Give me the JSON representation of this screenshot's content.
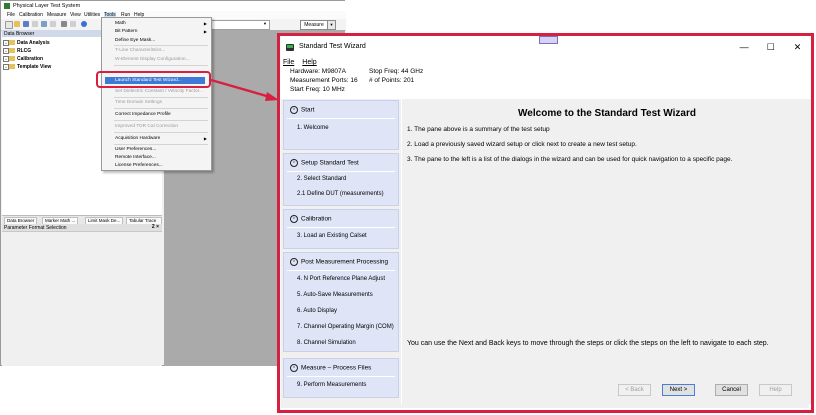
{
  "bg_app": {
    "title": "Physical Layer Test System",
    "menu": [
      "File",
      "Calibration",
      "Measure",
      "View",
      "Utilities",
      "Tools",
      "Run",
      "Help"
    ],
    "measure_button": "Measure",
    "data_browser": "Data Browser",
    "tree": [
      "Data Analysis",
      "RLCG",
      "Calibration",
      "Template View"
    ],
    "tabs": [
      "Data Browser",
      "Marker Math ...",
      "Limit Mask De...",
      "Tabular Trace ..."
    ],
    "param_panel": "Parameter Format Selection",
    "param_pin": "2 ×"
  },
  "tools_menu": {
    "items": [
      {
        "label": "Math",
        "submenu": true,
        "disabled": false
      },
      {
        "label": "Bit Pattern",
        "submenu": true,
        "disabled": false
      },
      {
        "label": "Define Eye Mask...",
        "disabled": false
      },
      {
        "label": "T-Line Characteristics...",
        "disabled": true
      },
      {
        "label": "W-Element Display Configuration...",
        "disabled": true
      },
      {
        "label": "Launch Standard Test Wizard...",
        "disabled": false,
        "highlighted": true
      },
      {
        "label": "Set Dielectric Constant / Velocity Factor...",
        "disabled": true
      },
      {
        "label": "Time Domain Settings",
        "disabled": true
      },
      {
        "label": "Correct Impedance Profile",
        "disabled": false
      },
      {
        "label": "Improved TDR Cal Correction",
        "disabled": true
      },
      {
        "label": "Acquisition Hardware",
        "submenu": true,
        "disabled": false
      },
      {
        "label": "User Preferences...",
        "disabled": false
      },
      {
        "label": "Remote Interface...",
        "disabled": false
      },
      {
        "label": "License Preferences...",
        "disabled": false
      }
    ]
  },
  "wizard": {
    "title": "Standard Test Wizard",
    "menu": [
      "File",
      "Help"
    ],
    "summary": {
      "hardware": "Hardware: M9807A",
      "ports": "Measurement Ports: 16",
      "start_freq": "Start Freq: 10 MHz",
      "stop_freq": "Stop Freq: 44 GHz",
      "points": "# of Points: 201"
    },
    "nav": [
      {
        "header": "Start",
        "items": [
          "1. Welcome"
        ]
      },
      {
        "header": "Setup Standard Test",
        "items": [
          "2. Select Standard",
          "2.1 Define DUT  (measurements)"
        ]
      },
      {
        "header": "Calibration",
        "items": [
          "3. Load an Existing Calset"
        ]
      },
      {
        "header": "Post Measurement Processing",
        "items": [
          "4. N Port Reference Plane Adjust",
          "5. Auto-Save Measurements",
          "6. Auto Display",
          "7. Channel Operating Margin (COM)",
          "8. Channel Simulation"
        ]
      },
      {
        "header": "Measure – Process Files",
        "items": [
          "9. Perform Measurements"
        ]
      }
    ],
    "heading": "Welcome to the Standard Test Wizard",
    "lines": [
      "1. The pane above is a summary of the test setup",
      "2. Load a previously saved wizard setup or click next to create a new test setup.",
      "3. The pane to the left is a list of the dialogs in the wizard and can be used  for quick navigation to a specific page."
    ],
    "bottom_text": "You can use the Next and Back keys to move through the steps or click the steps on the left to navigate to each step.",
    "buttons": {
      "back": "< Back",
      "next": "Next >",
      "cancel": "Cancel",
      "help": "Help"
    },
    "window_controls": {
      "minimize": "—",
      "maximize": "☐",
      "close": "✕"
    }
  },
  "colors": {
    "callout": "#d71f3f",
    "highlight": "#3d79d6",
    "nav_panel": "#dfe4f7"
  }
}
